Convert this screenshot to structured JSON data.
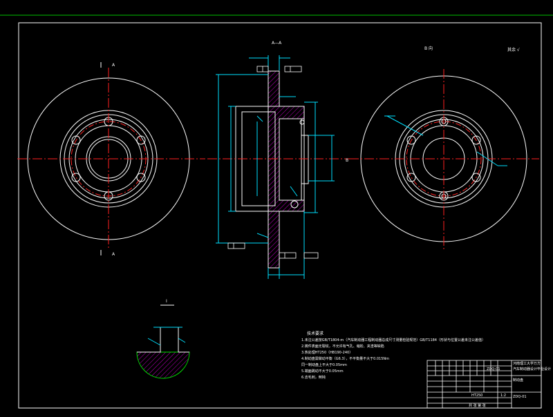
{
  "view_labels": {
    "section": "A—A",
    "right_view": "B 向",
    "detail": "I",
    "mark_a": "A",
    "mark_b": "B",
    "roughness_note": "其余 √"
  },
  "tech_requirements": {
    "title": "技术要求",
    "lines": [
      "1.未注公差按GB/T1804-m（汽车制动器工程制动器总成尺寸测量检验规范）GB/T1184（形状与位置公差未注公差值）",
      "2.铸件表面无裂纹，不允许有气孔、缩松、夹渣等缺陷",
      "3.热处理HT250（HB190-240）",
      "4.制动盘需做动平衡（G6.3），不平衡量不大于0.015Nm",
      "  同一制动盘上不大于0.05mm",
      "5.端面跳动不大于0.05mm",
      "6.去毛刺，倒钝"
    ]
  },
  "title_block": {
    "school": "河南理工大学万方",
    "project": "汽车制动器设计毕业设计",
    "part_name": "制动盘",
    "material": "HT250",
    "scale": "1:2",
    "drawing_no": "ZDQ-01",
    "sheet": "共 张 第 张",
    "code": "ZDQ-01"
  }
}
